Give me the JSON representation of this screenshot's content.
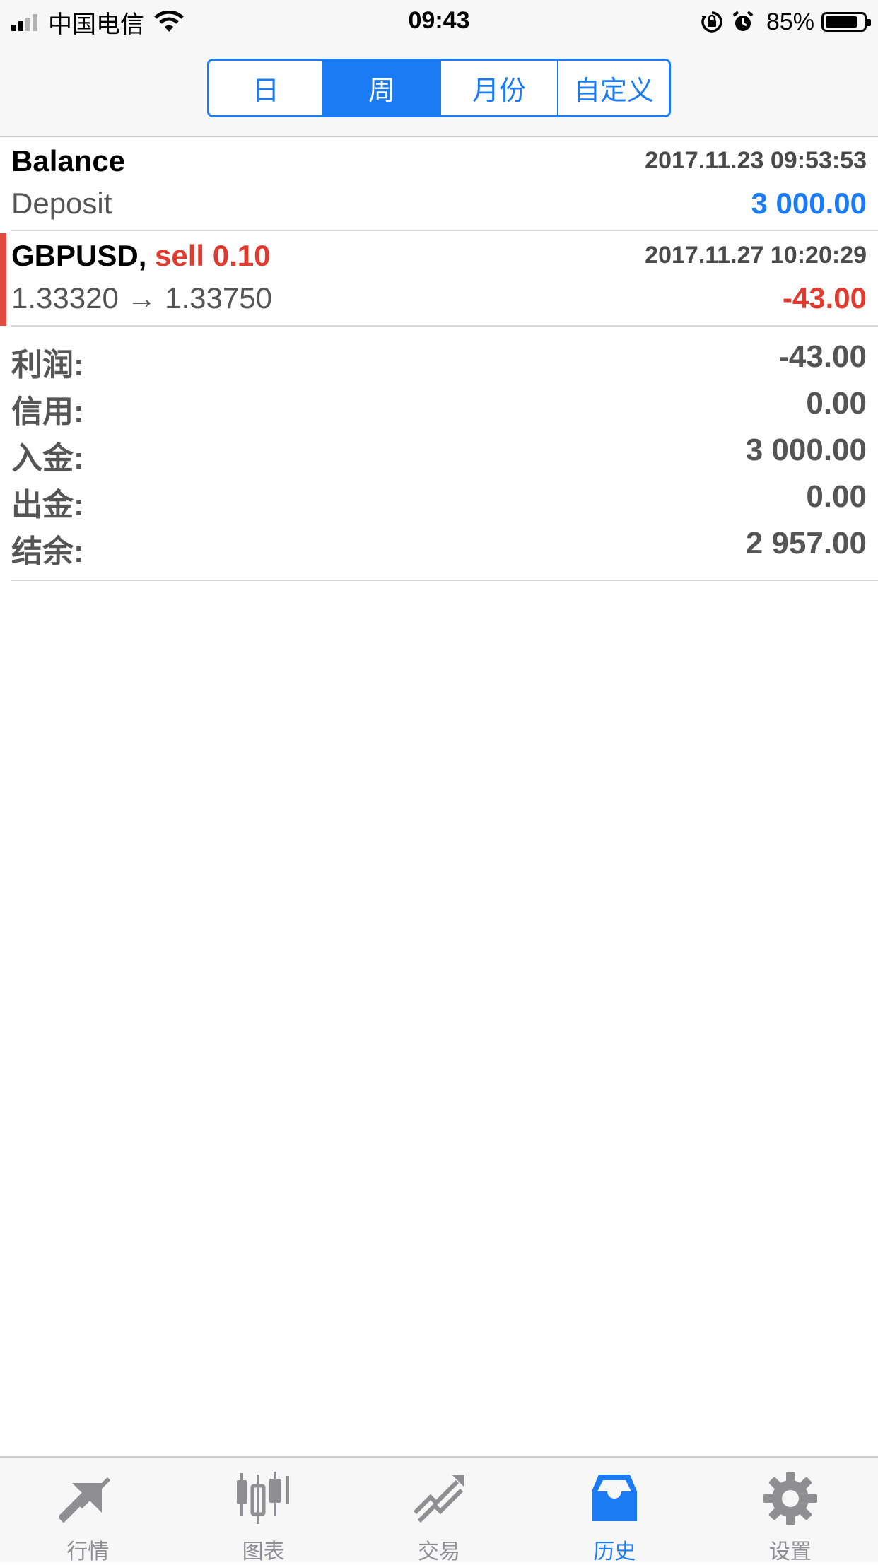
{
  "status": {
    "carrier": "中国电信",
    "time": "09:43",
    "battery": "85%",
    "battery_level": 0.85
  },
  "segments": [
    {
      "label": "日",
      "active": false
    },
    {
      "label": "周",
      "active": true
    },
    {
      "label": "月份",
      "active": false
    },
    {
      "label": "自定义",
      "active": false
    }
  ],
  "history": [
    {
      "symbol": "Balance",
      "action": "",
      "timestamp": "2017.11.23 09:53:53",
      "detail": "Deposit",
      "amount": "3 000.00",
      "amount_color": "#1a7bf5"
    },
    {
      "symbol": "GBPUSD,",
      "action": "sell 0.10",
      "timestamp": "2017.11.27 10:20:29",
      "detail": "1.33320 → 1.33750",
      "amount": "-43.00",
      "amount_color": "#e03a2f"
    }
  ],
  "summary": [
    {
      "label": "利润:",
      "value": "-43.00"
    },
    {
      "label": "信用:",
      "value": "0.00"
    },
    {
      "label": "入金:",
      "value": "3 000.00"
    },
    {
      "label": "出金:",
      "value": "0.00"
    },
    {
      "label": "结余:",
      "value": "2 957.00"
    }
  ],
  "tabs": [
    {
      "label": "行情",
      "icon": "quotes-arrows-icon",
      "active": false
    },
    {
      "label": "图表",
      "icon": "candlestick-chart-icon",
      "active": false
    },
    {
      "label": "交易",
      "icon": "trade-trend-icon",
      "active": false
    },
    {
      "label": "历史",
      "icon": "history-inbox-icon",
      "active": true
    },
    {
      "label": "设置",
      "icon": "gear-icon",
      "active": false
    }
  ],
  "colors": {
    "accent": "#1a7bf5",
    "loss": "#e03a2f",
    "inactive_icon": "#8e8e93"
  }
}
